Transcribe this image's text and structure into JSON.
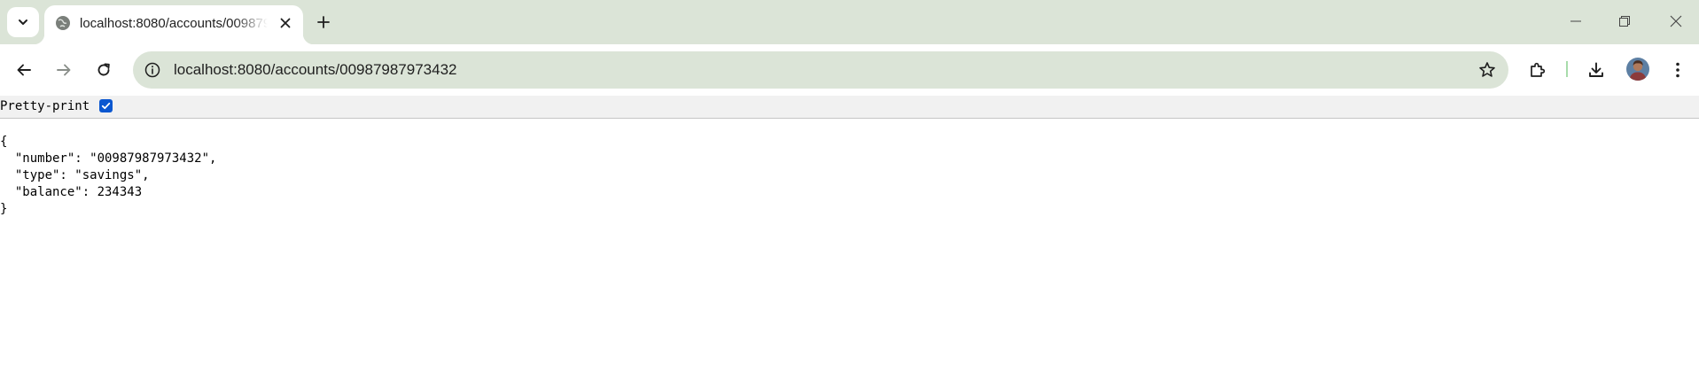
{
  "browser": {
    "tab": {
      "title": "localhost:8080/accounts/00987987973432",
      "favicon": "globe-icon"
    },
    "address_bar": {
      "url": "localhost:8080/accounts/00987987973432"
    },
    "icons": {
      "tab_search": "chevron-down-icon",
      "tab_close": "close-icon",
      "new_tab": "plus-icon",
      "back": "back-arrow-icon",
      "forward": "forward-arrow-icon",
      "reload": "reload-icon",
      "site_info": "info-icon",
      "bookmark": "star-icon",
      "extensions": "puzzle-icon",
      "downloads": "download-icon",
      "profile": "avatar",
      "menu": "kebab-menu-icon",
      "minimize": "minimize-icon",
      "restore": "restore-icon",
      "close_window": "close-icon"
    },
    "colors": {
      "frame": "#dbe4d7",
      "omnibox": "#dbe4d7",
      "checkbox_accent": "#0b57d0"
    }
  },
  "page": {
    "pretty_print": {
      "label": "Pretty-print",
      "checked": true
    },
    "json_lines": [
      "{",
      "  \"number\": \"00987987973432\",",
      "  \"type\": \"savings\",",
      "  \"balance\": 234343",
      "}"
    ]
  }
}
